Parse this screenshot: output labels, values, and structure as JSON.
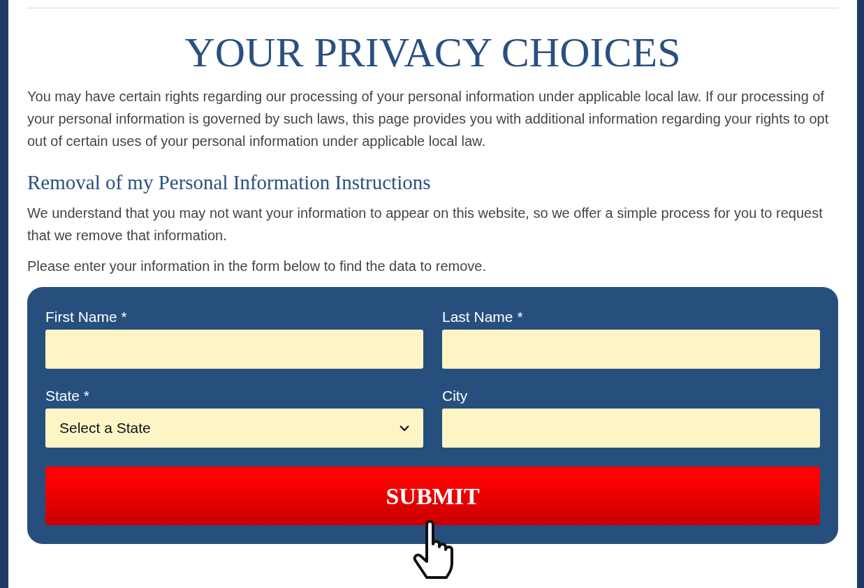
{
  "title": "YOUR PRIVACY CHOICES",
  "intro": "You may have certain rights regarding our processing of your personal information under applicable local law. If our processing of your personal information is governed by such laws, this page provides you with additional information regarding your rights to opt out of certain uses of your personal information under applicable local law.",
  "section": {
    "heading": "Removal of my Personal Information Instructions",
    "paragraphs": [
      "We understand that you may not want your information to appear on this website, so we offer a simple process for you to request that we remove that information.",
      "Please enter your information in the form below to find the data to remove."
    ]
  },
  "form": {
    "fields": [
      {
        "label": "First Name *",
        "kind": "text"
      },
      {
        "label": "Last Name *",
        "kind": "text"
      },
      {
        "label": "State *",
        "kind": "select",
        "value": "Select a State"
      },
      {
        "label": "City",
        "kind": "text"
      }
    ],
    "submit": "SUBMIT"
  }
}
